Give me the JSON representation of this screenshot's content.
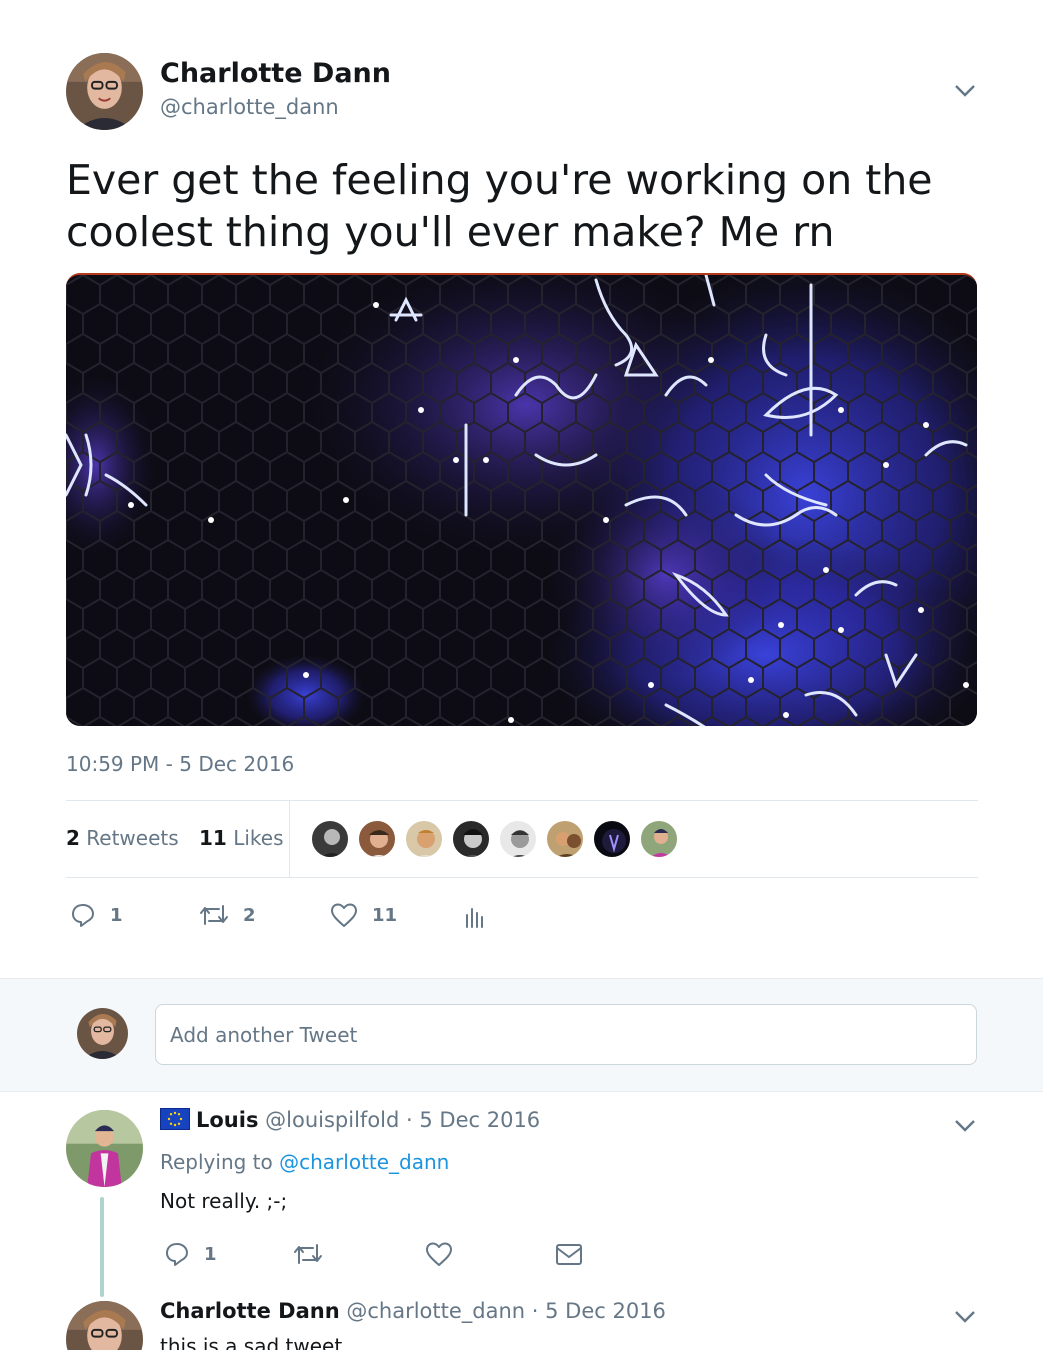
{
  "tweet": {
    "author_name": "Charlotte Dann",
    "author_handle": "@charlotte_dann",
    "text": "Ever get the feeling you're working on the coolest thing you'll ever make? Me rn",
    "timestamp": "10:59 PM - 5 Dec 2016",
    "retweets_count": "2",
    "retweets_label": "Retweets",
    "likes_count": "11",
    "likes_label": "Likes",
    "actions": {
      "reply_count": "1",
      "retweet_count": "2",
      "like_count": "11"
    },
    "likers_count": 8
  },
  "compose": {
    "placeholder": "Add another Tweet"
  },
  "replies": [
    {
      "name": "Louis",
      "handle": "@louispilfold",
      "meta": "· 5 Dec 2016",
      "replying_prefix": "Replying to",
      "replying_to": "@charlotte_dann",
      "text": "Not really. ;-;",
      "reply_count": "1"
    },
    {
      "name": "Charlotte Dann",
      "handle": "@charlotte_dann",
      "meta": "· 5 Dec 2016",
      "text": "this is a sad tweet"
    }
  ],
  "colors": {
    "text": "#14171a",
    "secondary": "#657786",
    "link": "#1b95e0",
    "border": "#e1e8ed",
    "band": "#f5f8fa"
  },
  "icons": [
    "chevron-down-icon",
    "reply-icon",
    "retweet-icon",
    "like-icon",
    "analytics-icon",
    "message-icon",
    "eu-flag-icon"
  ]
}
